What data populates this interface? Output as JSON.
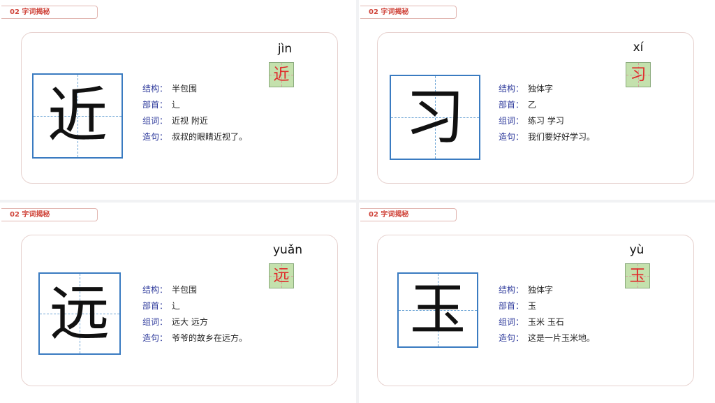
{
  "header_label": "02  字词揭秘",
  "labels": {
    "structure": "结构：",
    "radical": "部首：",
    "words": "组词：",
    "sentence": "造句："
  },
  "cards": [
    {
      "char": "近",
      "pinyin": "jìn",
      "structure": "半包围",
      "radical": "辶",
      "words": "近视   附近",
      "sentence": "叔叔的眼睛近视了。"
    },
    {
      "char": "习",
      "pinyin": "xí",
      "structure": "独体字",
      "radical": "乙",
      "words": "练习  学习",
      "sentence": "我们要好好学习。"
    },
    {
      "char": "远",
      "pinyin": "yuǎn",
      "structure": "半包围",
      "radical": "辶",
      "words": "远大    远方",
      "sentence": "爷爷的故乡在远方。"
    },
    {
      "char": "玉",
      "pinyin": "yù",
      "structure": "独体字",
      "radical": "玉",
      "words": "玉米   玉石",
      "sentence": "这是一片玉米地。"
    }
  ],
  "colors": {
    "accent_red": "#d0453b",
    "grid_blue": "#3a7bc1",
    "label_blue": "#2f3b9c",
    "box_green": "#c4e1ad"
  }
}
